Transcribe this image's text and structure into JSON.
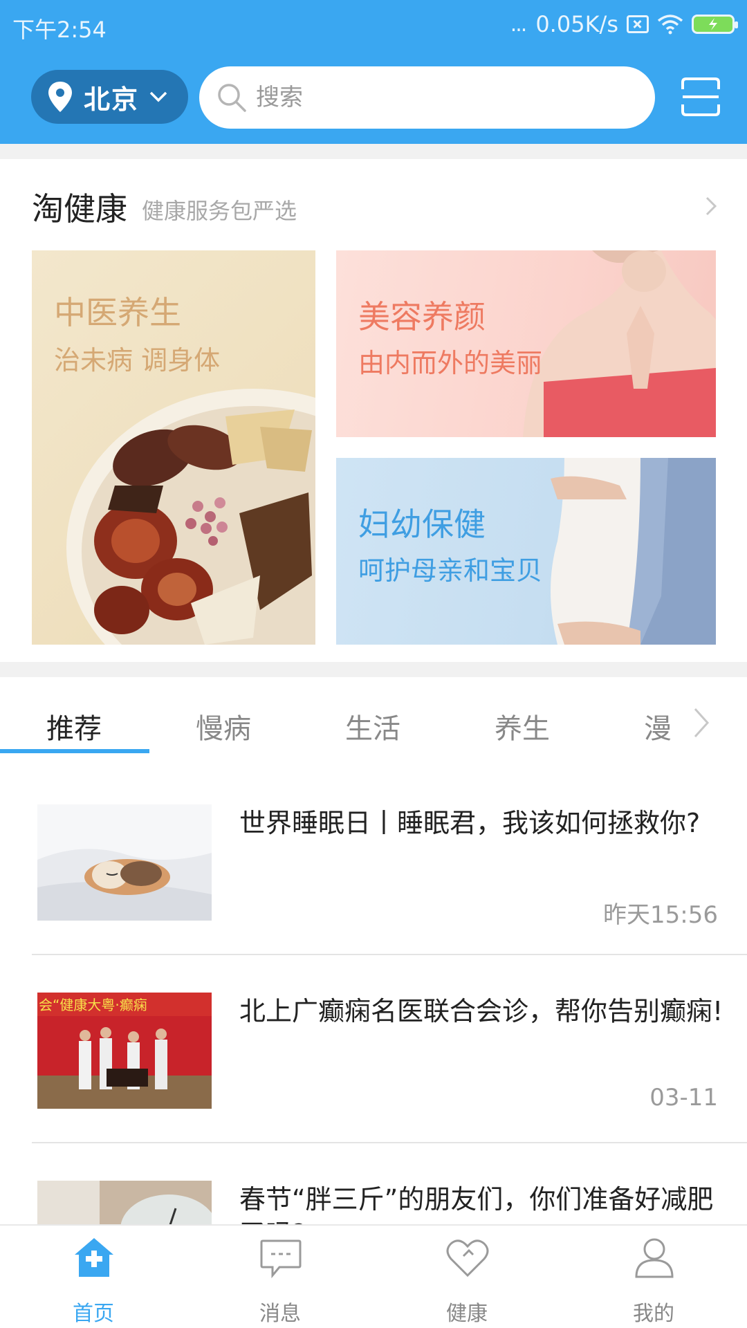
{
  "status_bar": {
    "time": "下午2:54",
    "dots": "...",
    "speed": "0.05K/s"
  },
  "header": {
    "city": "北京",
    "search_placeholder": "搜索",
    "accent_color": "#3aa7f1"
  },
  "section": {
    "title": "淘健康",
    "subtitle": "健康服务包严选"
  },
  "cards": [
    {
      "title": "中医养生",
      "desc": "治未病  调身体"
    },
    {
      "title": "美容养颜",
      "desc": "由内而外的美丽"
    },
    {
      "title": "妇幼保健",
      "desc": "呵护母亲和宝贝"
    }
  ],
  "tabs": [
    {
      "label": "推荐",
      "active": true
    },
    {
      "label": "慢病",
      "active": false
    },
    {
      "label": "生活",
      "active": false
    },
    {
      "label": "养生",
      "active": false
    },
    {
      "label": "漫",
      "active": false
    }
  ],
  "articles": [
    {
      "title": "世界睡眠日丨睡眠君，我该如何拯救你?",
      "time": "昨天15:56",
      "thumb_text": ""
    },
    {
      "title": "北上广癫痫名医联合会诊，帮你告别癫痫!",
      "time": "03-11",
      "thumb_text": "会“健康大粤·癫痫"
    },
    {
      "title": "春节“胖三斤”的朋友们，你们准备好减肥了吗?",
      "time": "",
      "thumb_text": ""
    }
  ],
  "bottom_nav": [
    {
      "label": "首页",
      "icon": "home-icon",
      "active": true
    },
    {
      "label": "消息",
      "icon": "message-icon",
      "active": false
    },
    {
      "label": "健康",
      "icon": "heart-icon",
      "active": false
    },
    {
      "label": "我的",
      "icon": "profile-icon",
      "active": false
    }
  ]
}
